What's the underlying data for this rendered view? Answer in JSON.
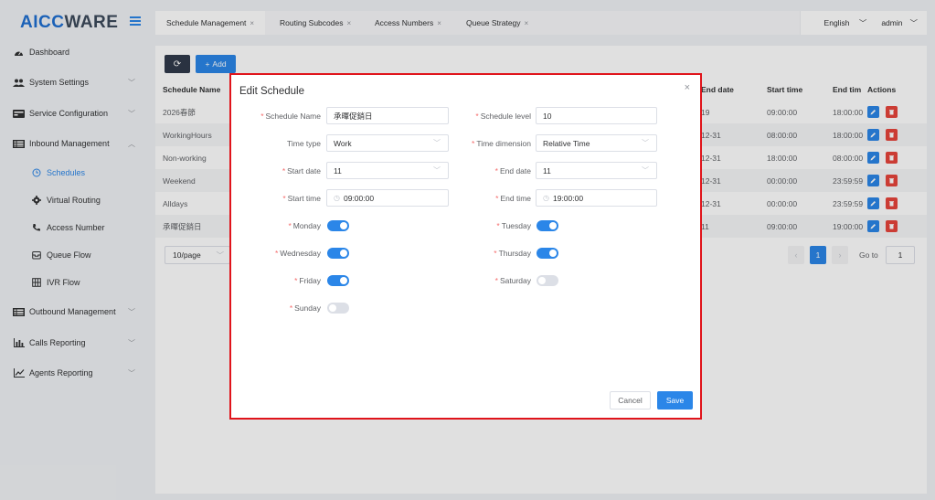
{
  "app": {
    "logo_main": "AICC",
    "logo_accent": "WARE"
  },
  "sidebar": {
    "items": [
      {
        "label": "Dashboard",
        "icon": "dashboard-icon"
      },
      {
        "label": "System Settings",
        "icon": "users-icon"
      },
      {
        "label": "Service Configuration",
        "icon": "credit-card-icon"
      },
      {
        "label": "Inbound Management",
        "icon": "list-icon"
      },
      {
        "label": "Schedules",
        "icon": "clock-icon"
      },
      {
        "label": "Virtual Routing",
        "icon": "gear-icon"
      },
      {
        "label": "Access Number",
        "icon": "phone-icon"
      },
      {
        "label": "Queue Flow",
        "icon": "inbox-icon"
      },
      {
        "label": "IVR Flow",
        "icon": "grid-icon"
      },
      {
        "label": "Outbound Management",
        "icon": "list-icon"
      },
      {
        "label": "Calls Reporting",
        "icon": "bar-chart-icon"
      },
      {
        "label": "Agents Reporting",
        "icon": "line-chart-icon"
      }
    ]
  },
  "tabs": [
    {
      "label": "Schedule Management"
    },
    {
      "label": "Routing Subcodes"
    },
    {
      "label": "Access Numbers"
    },
    {
      "label": "Queue Strategy"
    }
  ],
  "topbar": {
    "language": "English",
    "user": "admin"
  },
  "toolbar": {
    "add_label": "Add"
  },
  "table": {
    "headers": {
      "name": "Schedule Name",
      "end_date": "End date",
      "start_time": "Start time",
      "end_time": "End tim",
      "actions": "Actions"
    },
    "rows": [
      {
        "name": "2026春節",
        "end_date": "19",
        "start_time": "09:00:00",
        "end_time": "18:00:00"
      },
      {
        "name": "WorkingHours",
        "end_date": "12-31",
        "start_time": "08:00:00",
        "end_time": "18:00:00"
      },
      {
        "name": "Non-working",
        "end_date": "12-31",
        "start_time": "18:00:00",
        "end_time": "08:00:00"
      },
      {
        "name": "Weekend",
        "end_date": "12-31",
        "start_time": "00:00:00",
        "end_time": "23:59:59"
      },
      {
        "name": "Alldays",
        "end_date": "12-31",
        "start_time": "00:00:00",
        "end_time": "23:59:59"
      },
      {
        "name": "承暉促銷日",
        "end_date": "11",
        "start_time": "09:00:00",
        "end_time": "19:00:00"
      }
    ]
  },
  "pagination": {
    "page_size": "10/page",
    "current_page": "1",
    "goto_label": "Go to",
    "goto_value": "1"
  },
  "dialog": {
    "title": "Edit Schedule",
    "close": "×",
    "fields": {
      "schedule_name": {
        "label": "Schedule Name",
        "value": "承暉促銷日"
      },
      "schedule_level": {
        "label": "Schedule level",
        "value": "10"
      },
      "time_type": {
        "label": "Time type",
        "value": "Work"
      },
      "time_dimension": {
        "label": "Time dimension",
        "value": "Relative Time"
      },
      "start_date": {
        "label": "Start date",
        "value": "11"
      },
      "end_date": {
        "label": "End date",
        "value": "11"
      },
      "start_time": {
        "label": "Start time",
        "value": "09:00:00"
      },
      "end_time": {
        "label": "End time",
        "value": "19:00:00"
      }
    },
    "days": {
      "monday": {
        "label": "Monday",
        "on": true
      },
      "tuesday": {
        "label": "Tuesday",
        "on": true
      },
      "wednesday": {
        "label": "Wednesday",
        "on": true
      },
      "thursday": {
        "label": "Thursday",
        "on": true
      },
      "friday": {
        "label": "Friday",
        "on": true
      },
      "saturday": {
        "label": "Saturday",
        "on": false
      },
      "sunday": {
        "label": "Sunday",
        "on": false
      }
    },
    "cancel_label": "Cancel",
    "save_label": "Save"
  },
  "colors": {
    "accent": "#2b86e8",
    "danger": "#e8453c",
    "highlight_border": "#e0141b"
  }
}
